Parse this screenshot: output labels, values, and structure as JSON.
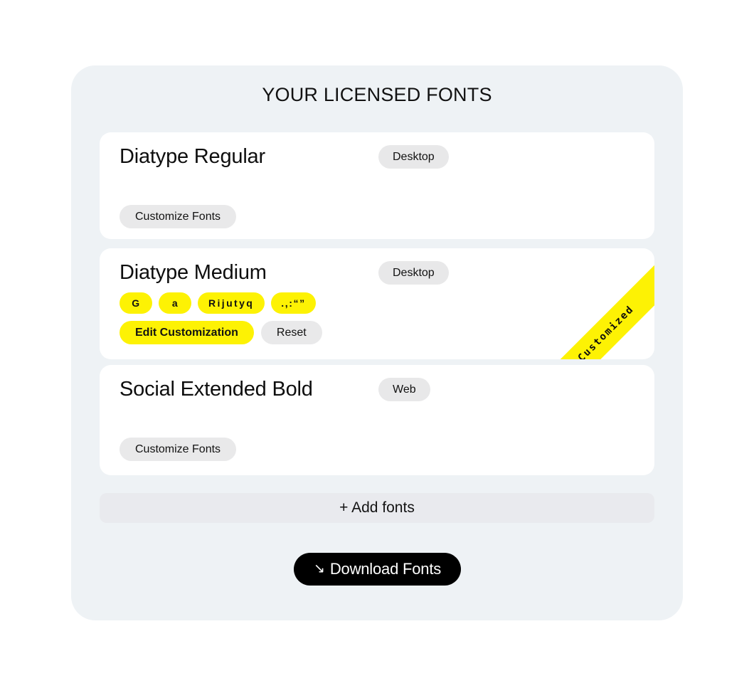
{
  "panel": {
    "title": "YOUR LICENSED FONTS"
  },
  "cards": [
    {
      "name": "Diatype Regular",
      "license_badge": "Desktop",
      "customize_label": "Customize Fonts",
      "customized": false
    },
    {
      "name": "Diatype Medium",
      "license_badge": "Desktop",
      "customized": true,
      "ribbon_label": "Customized",
      "glyph_pills": [
        "G",
        "a",
        "Rijutyq",
        ".,:“”"
      ],
      "edit_label": "Edit Customization",
      "reset_label": "Reset"
    },
    {
      "name": "Social Extended Bold",
      "license_badge": "Web",
      "customize_label": "Customize Fonts",
      "customized": false
    }
  ],
  "add_fonts": {
    "label": "+ Add fonts"
  },
  "download": {
    "arrow_glyph": "↘",
    "label": "Download Fonts"
  },
  "colors": {
    "panel_bg": "#eef2f5",
    "card_bg": "#ffffff",
    "accent_yellow": "#fdf204",
    "badge_grey": "#e8e8e9",
    "add_bar_grey": "#e9eaee",
    "download_black": "#000000"
  }
}
